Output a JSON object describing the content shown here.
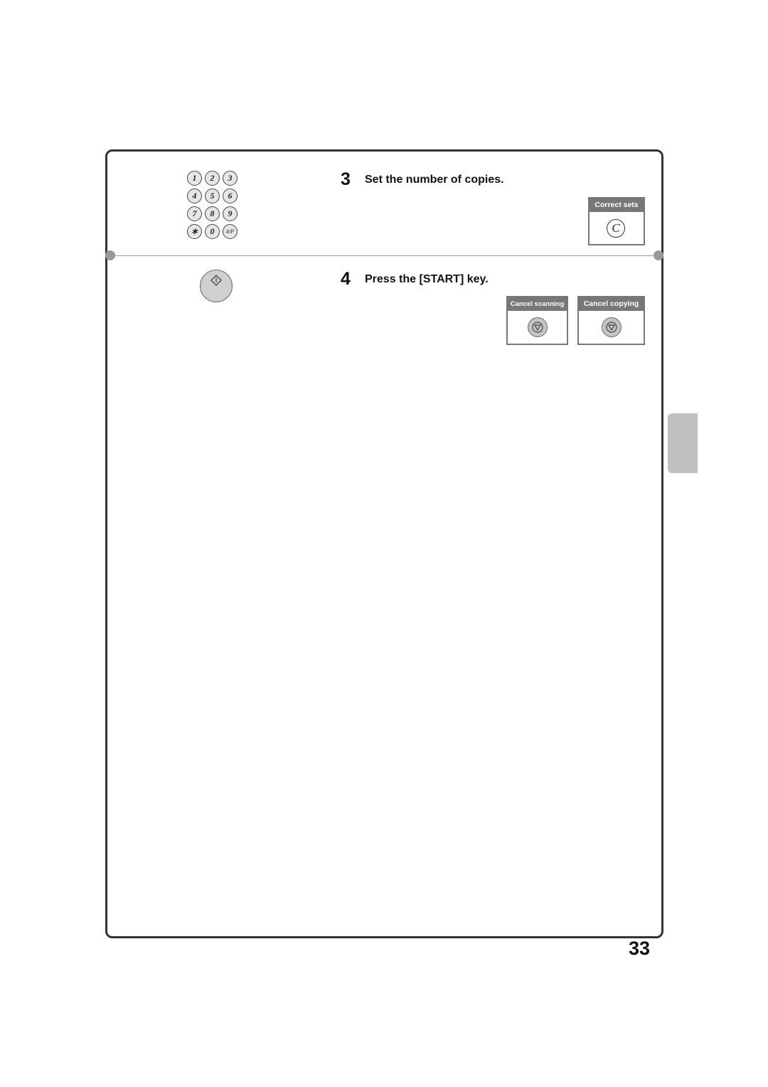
{
  "steps": [
    {
      "number": "3",
      "text": "Set the number of copies."
    },
    {
      "number": "4",
      "text": "Press the [START] key."
    }
  ],
  "keypad": {
    "keys": [
      "1",
      "2",
      "3",
      "4",
      "5",
      "6",
      "7",
      "8",
      "9",
      "∗",
      "0",
      "#/P"
    ]
  },
  "panels": {
    "correct_sets": {
      "header": "Correct sets",
      "key_label": "C"
    },
    "cancel_scanning": {
      "header": "Cancel scanning"
    },
    "cancel_copying": {
      "header": "Cancel copying"
    }
  },
  "page_number": "33"
}
